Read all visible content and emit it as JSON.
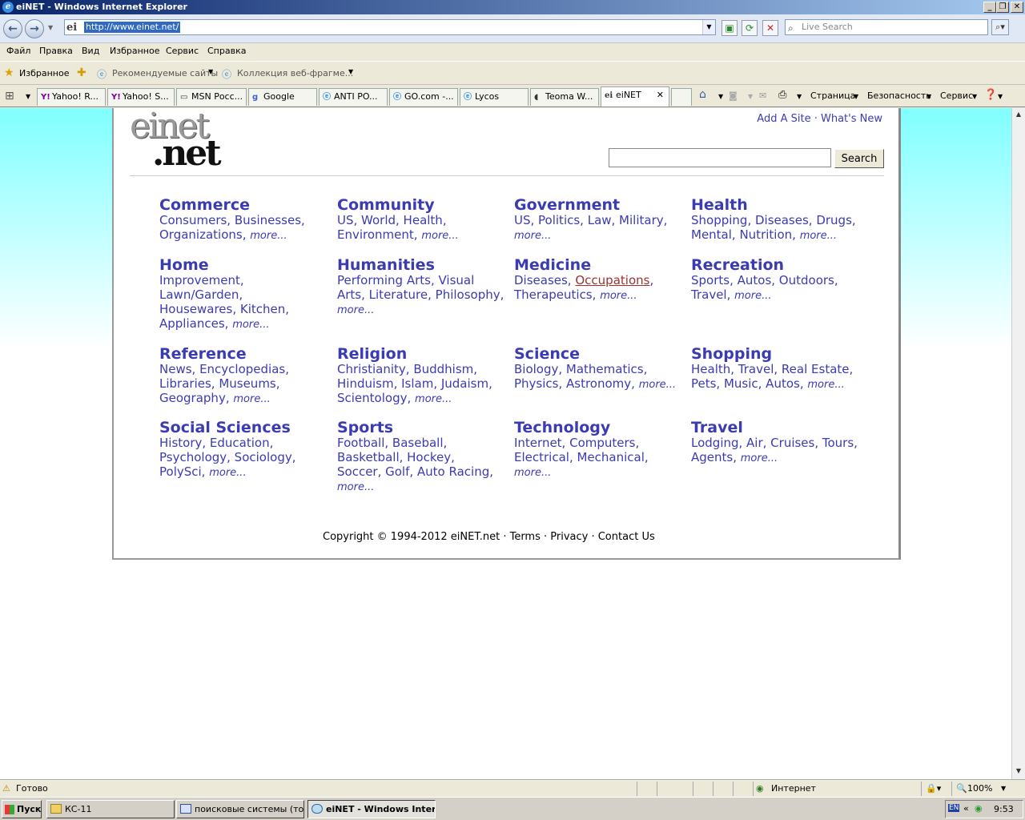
{
  "window": {
    "title": "eiNET - Windows Internet Explorer"
  },
  "address": {
    "url": "http://www.einet.net/",
    "search_placeholder": "Live Search"
  },
  "menu": [
    "Файл",
    "Правка",
    "Вид",
    "Избранное",
    "Сервис",
    "Справка"
  ],
  "favorites_bar": {
    "favorites": "Избранное",
    "recommended": "Рекомендуемые сайты",
    "gallery": "Коллекция веб-фрагме..."
  },
  "tabs": [
    "Yahoo! R...",
    "Yahoo! S...",
    "MSN Росс...",
    "Google",
    "ANTI PO...",
    "GO.com -...",
    "Lycos",
    "Teoma W...",
    "eiNET"
  ],
  "commandbar": {
    "page": "Страница",
    "security": "Безопасность",
    "tools": "Сервис"
  },
  "site": {
    "logo_line1": "einet",
    "logo_line2": ".net",
    "add_site": "Add A Site",
    "dot": "·",
    "whats_new": "What's New",
    "search_button": "Search",
    "categories": [
      {
        "title": "Commerce",
        "links": "Consumers, Businesses, Organizations,",
        "more": "more..."
      },
      {
        "title": "Community",
        "links": "US, World, Health, Environment,",
        "more": "more..."
      },
      {
        "title": "Government",
        "links": "US, Politics, Law, Military,",
        "more": "more..."
      },
      {
        "title": "Health",
        "links": "Shopping, Diseases, Drugs, Mental, Nutrition,",
        "more": "more..."
      },
      {
        "title": "Home",
        "links": "Improvement, Lawn/Garden, Housewares, Kitchen, Appliances,",
        "more": "more..."
      },
      {
        "title": "Humanities",
        "links": "Performing Arts, Visual Arts, Literature, Philosophy,",
        "more": "more..."
      },
      {
        "title": "Medicine",
        "links_pre": "Diseases,",
        "links_red": "Occupations",
        "links_post": ", Therapeutics,",
        "more": "more..."
      },
      {
        "title": "Recreation",
        "links": "Sports, Autos, Outdoors, Travel,",
        "more": "more..."
      },
      {
        "title": "Reference",
        "links": "News, Encyclopedias, Libraries, Museums, Geography,",
        "more": "more..."
      },
      {
        "title": "Religion",
        "links": "Christianity, Buddhism, Hinduism, Islam, Judaism, Scientology,",
        "more": "more..."
      },
      {
        "title": "Science",
        "links": "Biology, Mathematics, Physics, Astronomy,",
        "more": "more..."
      },
      {
        "title": "Shopping",
        "links": "Health, Travel, Real Estate, Pets, Music, Autos,",
        "more": "more..."
      },
      {
        "title": "Social Sciences",
        "links": "History, Education, Psychology, Sociology, PolySci,",
        "more": "more..."
      },
      {
        "title": "Sports",
        "links": "Football, Baseball, Basketball, Hockey, Soccer, Golf, Auto Racing,",
        "more": "more..."
      },
      {
        "title": "Technology",
        "links": "Internet, Computers, Electrical, Mechanical,",
        "more": "more..."
      },
      {
        "title": "Travel",
        "links": "Lodging, Air, Cruises, Tours, Agents,",
        "more": "more..."
      }
    ],
    "footer": "Copyright © 1994-2012 eiNET.net · Terms · Privacy · Contact Us"
  },
  "status": {
    "text": "Готово",
    "zone": "Интернет",
    "zoom": "100%"
  },
  "taskbar": {
    "start": "Пуск",
    "items": [
      "КС-11",
      "поисковые системы (то...",
      "eiNET - Windows Inter..."
    ],
    "lang": "EN",
    "time": "9:53"
  }
}
